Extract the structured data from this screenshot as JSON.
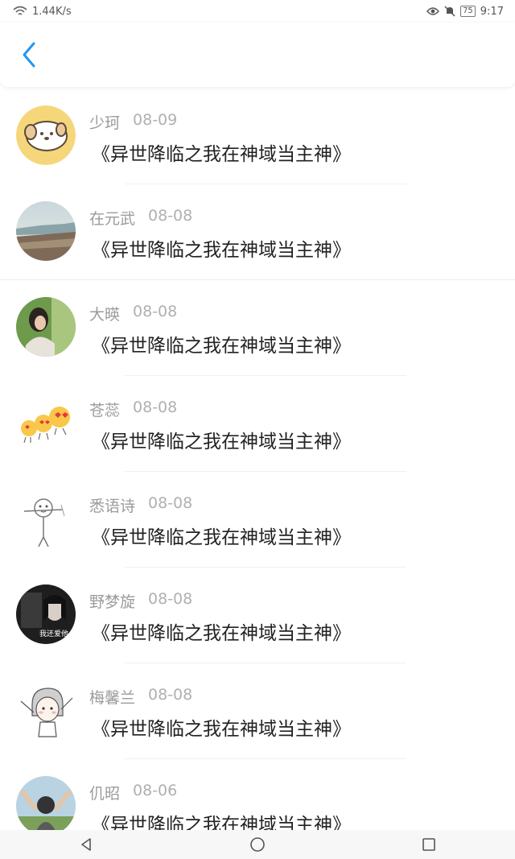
{
  "status_bar": {
    "speed": "1.44K/s",
    "battery": "75",
    "time": "9:17"
  },
  "header": {
    "back_icon": "chevron-left-icon",
    "accent": "#2196f3"
  },
  "items": [
    {
      "name": "少珂",
      "date": "08-09",
      "book": "《异世降临之我在神域当主神》"
    },
    {
      "name": "在元武",
      "date": "08-08",
      "book": "《异世降临之我在神域当主神》"
    },
    {
      "name": "大暎",
      "date": "08-08",
      "book": "《异世降临之我在神域当主神》"
    },
    {
      "name": "苍蕊",
      "date": "08-08",
      "book": "《异世降临之我在神域当主神》"
    },
    {
      "name": "悉语诗",
      "date": "08-08",
      "book": "《异世降临之我在神域当主神》"
    },
    {
      "name": "野梦旋",
      "date": "08-08",
      "book": "《异世降临之我在神域当主神》",
      "avatar_text": "我还爱他"
    },
    {
      "name": "梅馨兰",
      "date": "08-08",
      "book": "《异世降临之我在神域当主神》"
    },
    {
      "name": "仉昭",
      "date": "08-06",
      "book": "《异世降临之我在神域当主神》"
    }
  ],
  "nav": {
    "back": "triangle-back-icon",
    "home": "circle-home-icon",
    "recent": "square-recent-icon"
  }
}
